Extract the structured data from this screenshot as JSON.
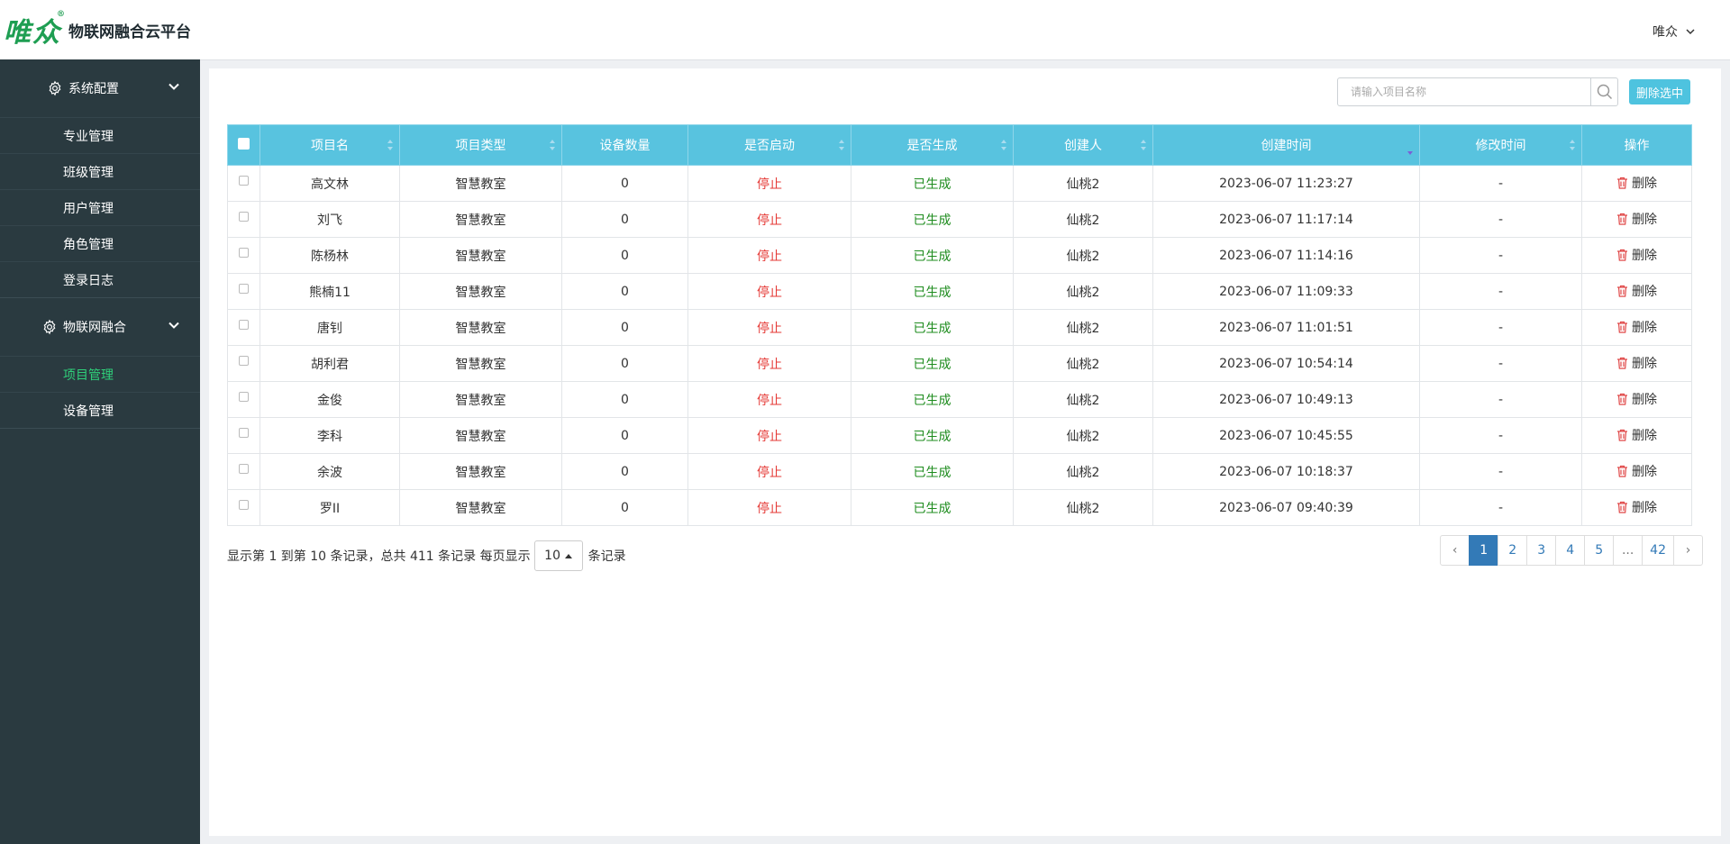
{
  "sidebar": {
    "logo_mark": "唯众",
    "logo_reg": "®",
    "logo_text": "物联网融合云平台",
    "groups": [
      {
        "label": "系统配置",
        "items": [
          {
            "label": "专业管理"
          },
          {
            "label": "班级管理"
          },
          {
            "label": "用户管理"
          },
          {
            "label": "角色管理"
          },
          {
            "label": "登录日志"
          }
        ]
      },
      {
        "label": "物联网融合",
        "items": [
          {
            "label": "项目管理",
            "active": true
          },
          {
            "label": "设备管理"
          }
        ]
      }
    ]
  },
  "header": {
    "user_name": "唯众"
  },
  "toolbar": {
    "search_placeholder": "请输入项目名称",
    "delete_selected_label": "删除选中"
  },
  "table": {
    "columns": [
      "项目名",
      "项目类型",
      "设备数量",
      "是否启动",
      "是否生成",
      "创建人",
      "创建时间",
      "修改时间",
      "操作"
    ],
    "rows": [
      {
        "name": "高文林",
        "type": "智慧教室",
        "count": "0",
        "started": "停止",
        "generated": "已生成",
        "creator": "仙桃2",
        "created": "2023-06-07 11:23:27",
        "modified": "-",
        "action": "删除"
      },
      {
        "name": "刘飞",
        "type": "智慧教室",
        "count": "0",
        "started": "停止",
        "generated": "已生成",
        "creator": "仙桃2",
        "created": "2023-06-07 11:17:14",
        "modified": "-",
        "action": "删除"
      },
      {
        "name": "陈杨林",
        "type": "智慧教室",
        "count": "0",
        "started": "停止",
        "generated": "已生成",
        "creator": "仙桃2",
        "created": "2023-06-07 11:14:16",
        "modified": "-",
        "action": "删除"
      },
      {
        "name": "熊楠11",
        "type": "智慧教室",
        "count": "0",
        "started": "停止",
        "generated": "已生成",
        "creator": "仙桃2",
        "created": "2023-06-07 11:09:33",
        "modified": "-",
        "action": "删除"
      },
      {
        "name": "唐钊",
        "type": "智慧教室",
        "count": "0",
        "started": "停止",
        "generated": "已生成",
        "creator": "仙桃2",
        "created": "2023-06-07 11:01:51",
        "modified": "-",
        "action": "删除"
      },
      {
        "name": "胡利君",
        "type": "智慧教室",
        "count": "0",
        "started": "停止",
        "generated": "已生成",
        "creator": "仙桃2",
        "created": "2023-06-07 10:54:14",
        "modified": "-",
        "action": "删除"
      },
      {
        "name": "金俊",
        "type": "智慧教室",
        "count": "0",
        "started": "停止",
        "generated": "已生成",
        "creator": "仙桃2",
        "created": "2023-06-07 10:49:13",
        "modified": "-",
        "action": "删除"
      },
      {
        "name": "李科",
        "type": "智慧教室",
        "count": "0",
        "started": "停止",
        "generated": "已生成",
        "creator": "仙桃2",
        "created": "2023-06-07 10:45:55",
        "modified": "-",
        "action": "删除"
      },
      {
        "name": "余波",
        "type": "智慧教室",
        "count": "0",
        "started": "停止",
        "generated": "已生成",
        "creator": "仙桃2",
        "created": "2023-06-07 10:18:37",
        "modified": "-",
        "action": "删除"
      },
      {
        "name": "罗II",
        "type": "智慧教室",
        "count": "0",
        "started": "停止",
        "generated": "已生成",
        "creator": "仙桃2",
        "created": "2023-06-07 09:40:39",
        "modified": "-",
        "action": "删除"
      }
    ]
  },
  "pager": {
    "info_prefix": "显示第 1 到第 10 条记录，总共 411 条记录 每页显示",
    "page_size": "10",
    "info_suffix": "条记录",
    "prev": "‹",
    "pages": [
      "1",
      "2",
      "3",
      "4",
      "5",
      "...",
      "42"
    ],
    "current": "1",
    "next": "›"
  },
  "colors": {
    "sidebar_bg": "#2a3a40",
    "accent": "#58c3df",
    "active_menu": "#2fd07a",
    "stopped": "#e53935",
    "generated": "#1e8c1e",
    "page_active": "#337ab7"
  }
}
